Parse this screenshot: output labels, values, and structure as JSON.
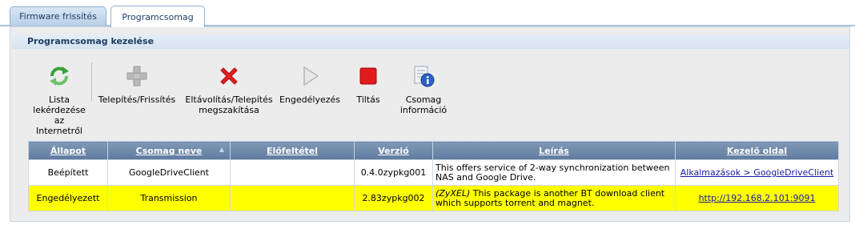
{
  "tabs": [
    {
      "label": "Firmware frissítés"
    },
    {
      "label": "Programcsomag"
    }
  ],
  "section_title": "Programcsomag kezelése",
  "toolbar": {
    "refresh_label": "Lista lekérdezése az Internetről",
    "install_label": "Telepítés/Frissítés",
    "remove_label": "Eltávolítás/Telepítés megszakítása",
    "enable_label": "Engedélyezés",
    "disable_label": "Tiltás",
    "info_label": "Csomag információ"
  },
  "table": {
    "headers": [
      "Állapot",
      "Csomag neve",
      "Előfeltétel",
      "Verzió",
      "Leírás",
      "Kezelő oldal"
    ],
    "rows": [
      {
        "status": "Beépített",
        "name": "GoogleDriveClient",
        "prereq": "",
        "version": "0.4.0zypkg001",
        "desc_prefix": "",
        "description": "This offers service of 2-way synchronization between NAS and Google Drive.",
        "link": "Alkalmazások > GoogleDriveClient"
      },
      {
        "status": "Engedélyezett",
        "name": "Transmission",
        "prereq": "",
        "version": "2.83zypkg002",
        "desc_prefix": "(ZyXEL)",
        "description": " This package is another BT download client which supports torrent and magnet.",
        "link": "http://192.168.2.101:9091"
      }
    ]
  },
  "colors": {
    "header_blue": "#6b86a8",
    "highlight_row": "#ffff00",
    "link": "#1a1aa6"
  }
}
